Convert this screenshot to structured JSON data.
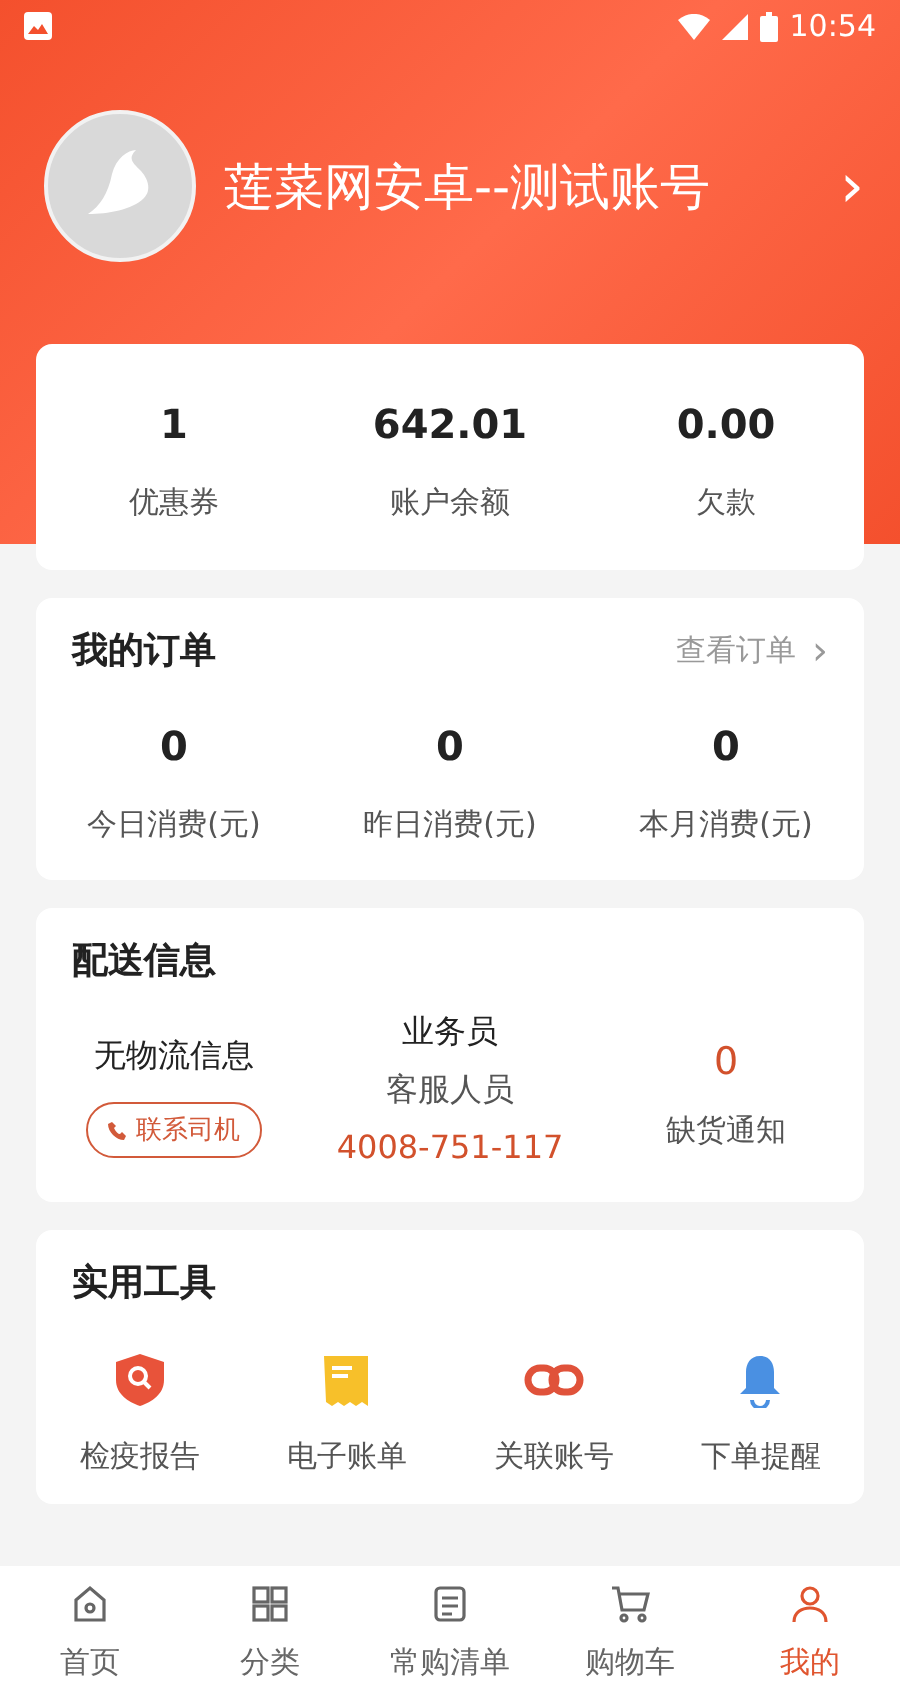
{
  "status_bar": {
    "time": "10:54"
  },
  "profile": {
    "name": "莲菜网安卓--测试账号",
    "chevron": "›"
  },
  "summary": [
    {
      "value": "1",
      "label": "优惠券"
    },
    {
      "value": "642.01",
      "label": "账户余额"
    },
    {
      "value": "0.00",
      "label": "欠款"
    }
  ],
  "orders": {
    "title": "我的订单",
    "link": "查看订单",
    "link_chevron": "›",
    "stats": [
      {
        "value": "0",
        "label": "今日消费(元)"
      },
      {
        "value": "0",
        "label": "昨日消费(元)"
      },
      {
        "value": "0",
        "label": "本月消费(元)"
      }
    ]
  },
  "delivery": {
    "title": "配送信息",
    "logistics": "无物流信息",
    "driver_button": "联系司机",
    "role": "业务员",
    "agent": "客服人员",
    "phone": "4008-751-117",
    "shortage_count": "0",
    "shortage_label": "缺货通知"
  },
  "tools": {
    "title": "实用工具",
    "items": [
      {
        "kind": "shield",
        "label": "检疫报告"
      },
      {
        "kind": "receipt",
        "label": "电子账单"
      },
      {
        "kind": "link",
        "label": "关联账号"
      },
      {
        "kind": "bell",
        "label": "下单提醒"
      }
    ]
  },
  "bottom_nav": [
    {
      "kind": "home",
      "label": "首页",
      "selected": false
    },
    {
      "kind": "grid",
      "label": "分类",
      "selected": false
    },
    {
      "kind": "list",
      "label": "常购清单",
      "selected": false
    },
    {
      "kind": "cart",
      "label": "购物车",
      "selected": false
    },
    {
      "kind": "user",
      "label": "我的",
      "selected": true
    }
  ]
}
